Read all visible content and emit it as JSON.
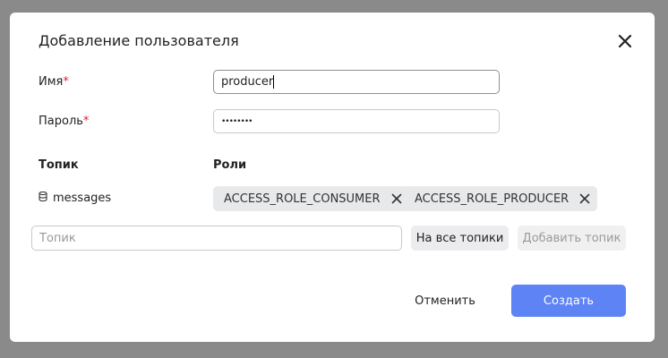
{
  "dialog": {
    "title": "Добавление пользователя",
    "close_icon": "close-icon"
  },
  "form": {
    "name_label": "Имя",
    "password_label": "Пароль",
    "required_mark": "*",
    "name_value": "producer",
    "password_value": "••••••••"
  },
  "topics_table": {
    "headers": [
      "Топик",
      "Роли"
    ],
    "rows": [
      {
        "topic": "messages",
        "icon": "database-icon",
        "roles": [
          "ACCESS_ROLE_CONSUMER",
          "ACCESS_ROLE_PRODUCER"
        ]
      }
    ]
  },
  "add_topic": {
    "placeholder": "Топик",
    "all_topics_label": "На все топики",
    "add_topic_label": "Добавить топик"
  },
  "footer": {
    "cancel_label": "Отменить",
    "create_label": "Создать"
  },
  "colors": {
    "primary": "#5d83f4",
    "required": "#e0203a",
    "chip_bg": "#e8e9eb"
  }
}
